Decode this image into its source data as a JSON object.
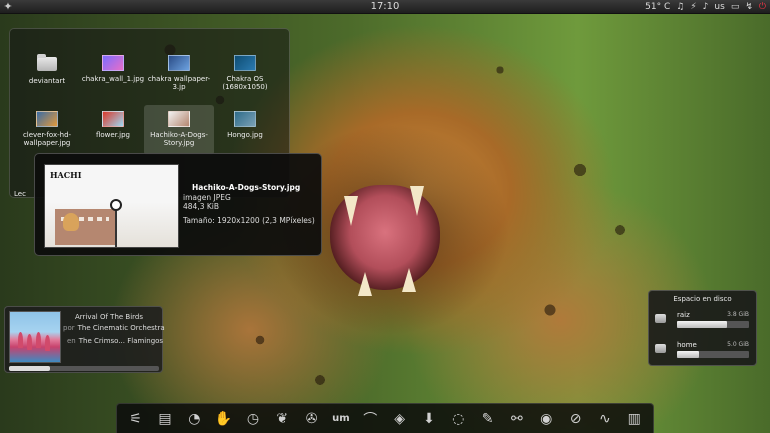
{
  "top_panel": {
    "menu_glyph": "✦",
    "clock": "17:10",
    "tray": {
      "temperature": "51° C",
      "keyboard_layout": "us",
      "power_glyph": "⏻",
      "icons": [
        "temperature-icon",
        "music-icon",
        "network-icon",
        "volume-icon",
        "keyboard-icon",
        "battery-icon",
        "usb-icon",
        "power-icon"
      ]
    }
  },
  "folder_view": {
    "items": [
      {
        "name": "deviantart",
        "kind": "folder"
      },
      {
        "name": "chakra_wall_1.jpg",
        "kind": "image",
        "thumb_colors": [
          "#7c6cff",
          "#e86fc8"
        ]
      },
      {
        "name": "chakra wallpaper-3.jp",
        "kind": "image",
        "thumb_colors": [
          "#2a4c86",
          "#6da2e0"
        ]
      },
      {
        "name": "Chakra OS (1680x1050)",
        "kind": "image",
        "thumb_colors": [
          "#0e4d73",
          "#2b7ab0"
        ]
      },
      {
        "name": "clever-fox-hd-wallpaper.jpg",
        "kind": "image",
        "thumb_colors": [
          "#3a6ca4",
          "#e39a3c"
        ]
      },
      {
        "name": "flower.jpg",
        "kind": "image",
        "thumb_colors": [
          "#d93a2c",
          "#9ed7f2"
        ]
      },
      {
        "name": "Hachiko-A-Dogs-Story.jpg",
        "kind": "image",
        "thumb_colors": [
          "#f0f0f0",
          "#b58770"
        ],
        "selected": true
      },
      {
        "name": "Hongo.jpg",
        "kind": "image",
        "thumb_colors": [
          "#2f6c8a",
          "#7aa1b5"
        ]
      }
    ],
    "partial_label": "Lec"
  },
  "tooltip": {
    "preview_title": "HACHI",
    "file_name": "Hachiko-A-Dogs-Story.jpg",
    "file_type": "imagen JPEG",
    "file_size": "484,3 KiB",
    "resolution": "Tamaño: 1920x1200 (2,3 MPíxeles)"
  },
  "media_player": {
    "title": "Arrival Of The Birds",
    "artist_label": "por",
    "artist": "The Cinematic Orchestra",
    "album_label": "en",
    "album": "The Crimso... Flamingos",
    "progress": 0.27
  },
  "disk_widget": {
    "title": "Espacio en disco",
    "disks": [
      {
        "name": "raiz",
        "size": "3.8 GiB",
        "used_fraction": 0.7
      },
      {
        "name": "home",
        "size": "5.0 GiB",
        "used_fraction": 0.3
      }
    ]
  },
  "dock": {
    "items": [
      {
        "id": "mixer-icon",
        "glyph": "⚟"
      },
      {
        "id": "files-icon",
        "glyph": "▤"
      },
      {
        "id": "firefox-icon",
        "glyph": "◔"
      },
      {
        "id": "hands-icon",
        "glyph": "✋"
      },
      {
        "id": "speedometer-icon",
        "glyph": "◷"
      },
      {
        "id": "bird-icon",
        "glyph": "❦"
      },
      {
        "id": "game-icon",
        "glyph": "✇"
      },
      {
        "id": "um-icon",
        "glyph": "um"
      },
      {
        "id": "wing-icon",
        "glyph": "⌒"
      },
      {
        "id": "stack-icon",
        "glyph": "◈"
      },
      {
        "id": "download-icon",
        "glyph": "⬇"
      },
      {
        "id": "spiral-icon",
        "glyph": "◌"
      },
      {
        "id": "pen-icon",
        "glyph": "✎"
      },
      {
        "id": "pdf-icon",
        "glyph": "⚯"
      },
      {
        "id": "eye-icon",
        "glyph": "◉"
      },
      {
        "id": "compass-icon",
        "glyph": "⊘"
      },
      {
        "id": "pulse-icon",
        "glyph": "∿"
      },
      {
        "id": "stats-icon",
        "glyph": "▥"
      }
    ]
  }
}
